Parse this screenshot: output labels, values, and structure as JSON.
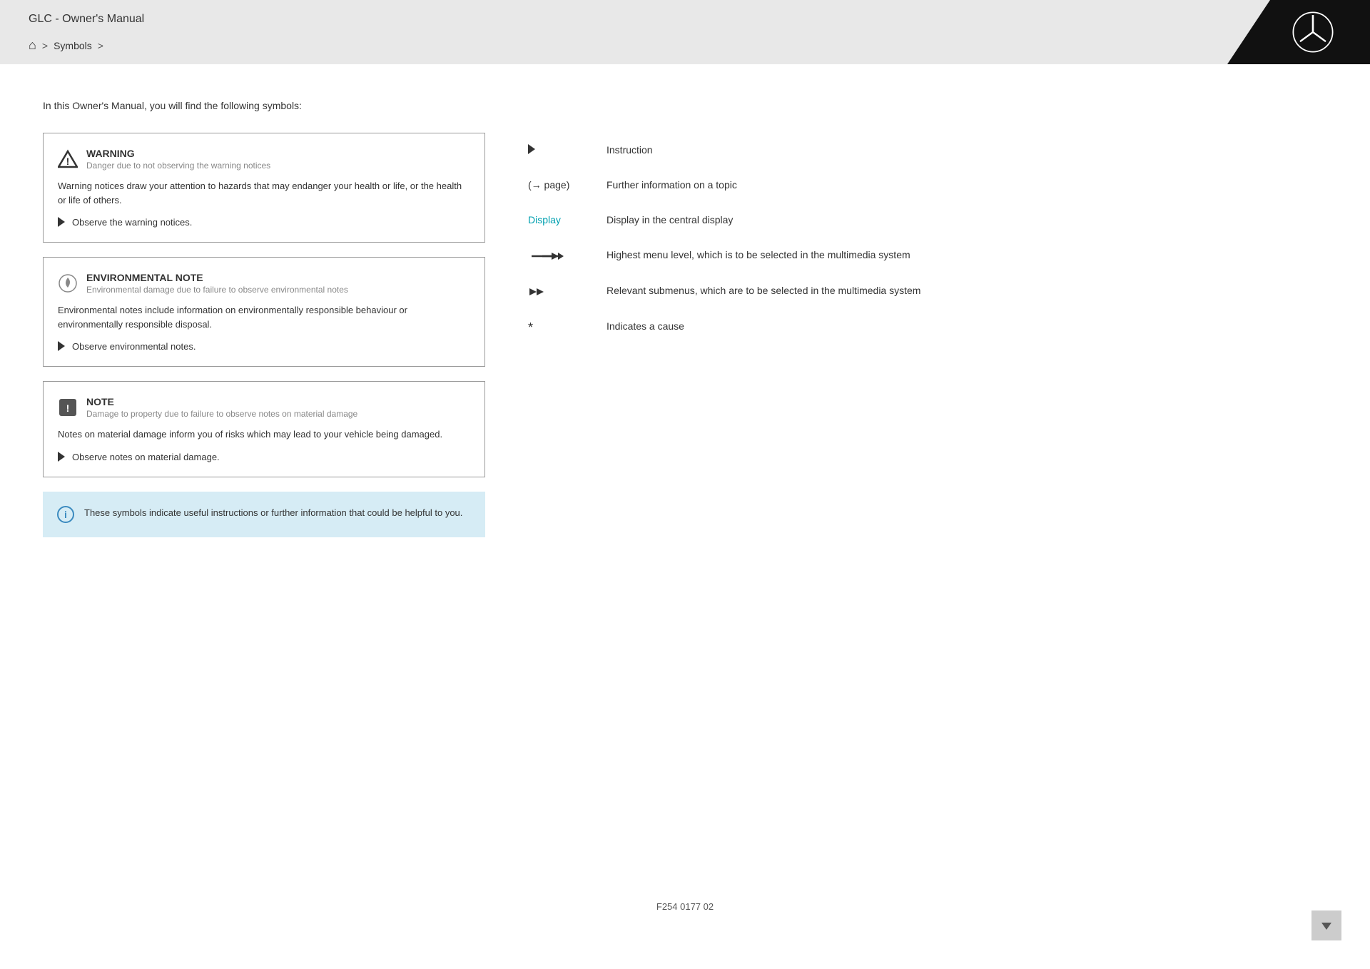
{
  "header": {
    "title": "GLC - Owner's Manual",
    "breadcrumb": {
      "home_label": "🏠",
      "separator": ">",
      "current": "Symbols",
      "arrow": ">"
    }
  },
  "intro": {
    "text": "In this Owner's Manual, you will find the following symbols:"
  },
  "notices": [
    {
      "id": "warning",
      "title": "WARNING",
      "subtitle": "Danger due to not observing the warning notices",
      "body": "Warning notices draw your attention to hazards that may endanger your health or life, or the health or life of others.",
      "instruction": "Observe the warning notices."
    },
    {
      "id": "environmental",
      "title": "ENVIRONMENTAL NOTE",
      "subtitle": "Environmental damage due to failure to observe environmental notes",
      "body": "Environmental notes include information on environmentally responsible behaviour or environmentally responsible disposal.",
      "instruction": "Observe environmental notes."
    },
    {
      "id": "note",
      "title": "NOTE",
      "subtitle": "Damage to property due to failure to observe notes on material damage",
      "body": "Notes on material damage inform you of risks which may lead to your vehicle being damaged.",
      "instruction": "Observe notes on material damage."
    }
  ],
  "info_box": {
    "text": "These symbols indicate useful instructions or further information that could be helpful to you."
  },
  "symbols": [
    {
      "icon_type": "arrow",
      "label": "",
      "description": "Instruction"
    },
    {
      "icon_type": "page-ref",
      "label": "(→ page)",
      "description": "Further information on a topic"
    },
    {
      "icon_type": "display",
      "label": "Display",
      "description": "Display in the central display"
    },
    {
      "icon_type": "menu-arrow",
      "label": "",
      "description": "Highest menu level, which is to be selected in the multimedia system"
    },
    {
      "icon_type": "double-arrow",
      "label": "",
      "description": "Relevant submenus, which are to be selected in the multimedia system"
    },
    {
      "icon_type": "asterisk",
      "label": "*",
      "description": "Indicates a cause"
    }
  ],
  "footer": {
    "code": "F254 0177 02"
  }
}
